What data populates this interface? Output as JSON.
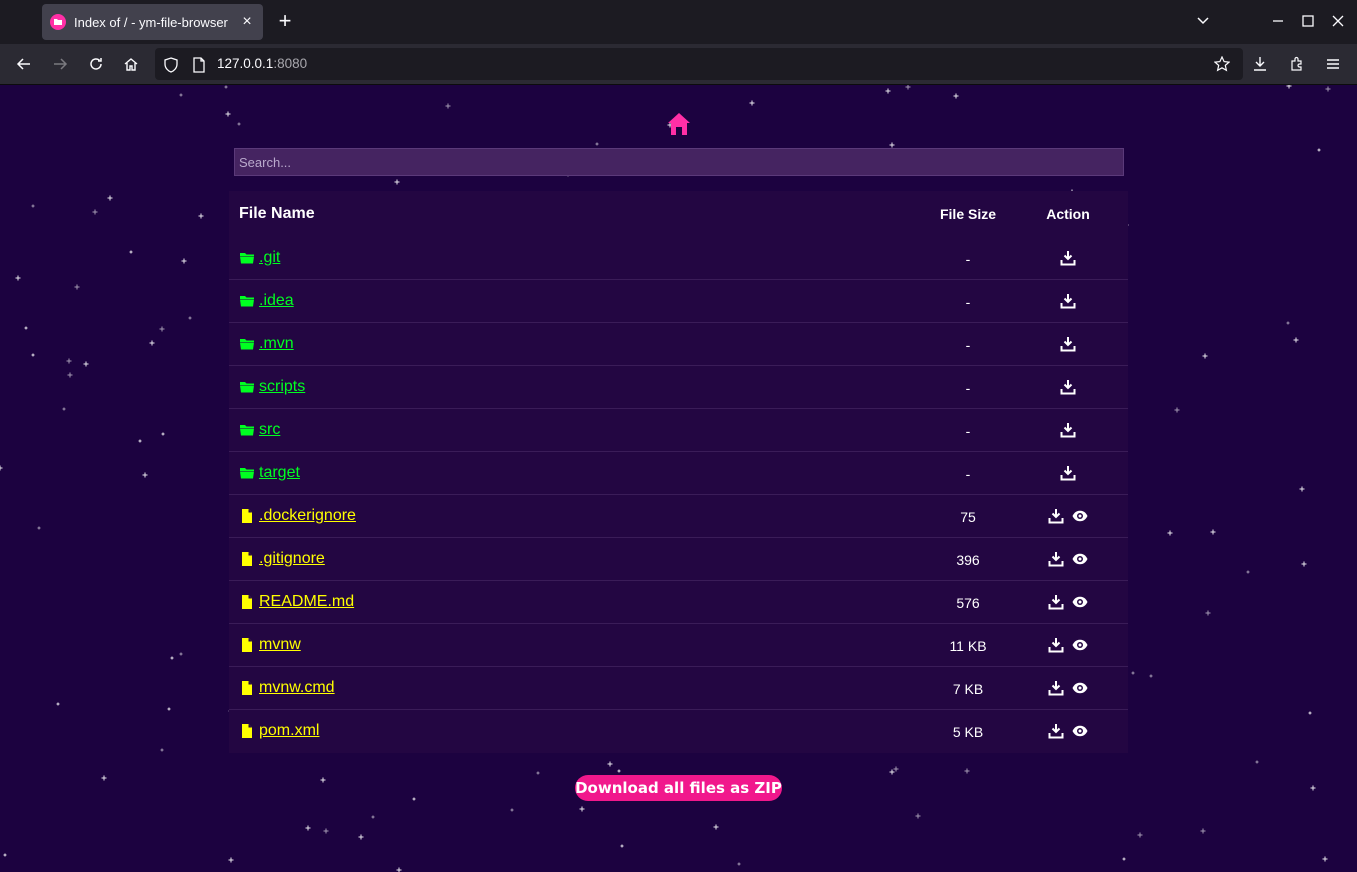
{
  "browser": {
    "tab_title": "Index of / - ym-file-browser",
    "tab_close": "×",
    "new_tab": "+",
    "url_host": "127.0.0.1",
    "url_port": ":8080"
  },
  "page": {
    "search_placeholder": "Search...",
    "columns": {
      "name": "File Name",
      "size": "File Size",
      "action": "Action"
    },
    "rows": [
      {
        "type": "folder",
        "name": ".git",
        "size": "-"
      },
      {
        "type": "folder",
        "name": ".idea",
        "size": "-"
      },
      {
        "type": "folder",
        "name": ".mvn",
        "size": "-"
      },
      {
        "type": "folder",
        "name": "scripts",
        "size": "-"
      },
      {
        "type": "folder",
        "name": "src",
        "size": "-"
      },
      {
        "type": "folder",
        "name": "target",
        "size": "-"
      },
      {
        "type": "file",
        "name": ".dockerignore",
        "size": "75"
      },
      {
        "type": "file",
        "name": ".gitignore",
        "size": "396"
      },
      {
        "type": "file",
        "name": "README.md",
        "size": "576"
      },
      {
        "type": "file",
        "name": "mvnw",
        "size": "11 KB"
      },
      {
        "type": "file",
        "name": "mvnw.cmd",
        "size": "7 KB"
      },
      {
        "type": "file",
        "name": "pom.xml",
        "size": "5 KB"
      }
    ],
    "zip_button": "Download all files as ZIP",
    "colors": {
      "background": "#1c0240",
      "folder_link": "#00ff21",
      "file_link": "#ffff00",
      "accent": "#f1188c"
    }
  }
}
